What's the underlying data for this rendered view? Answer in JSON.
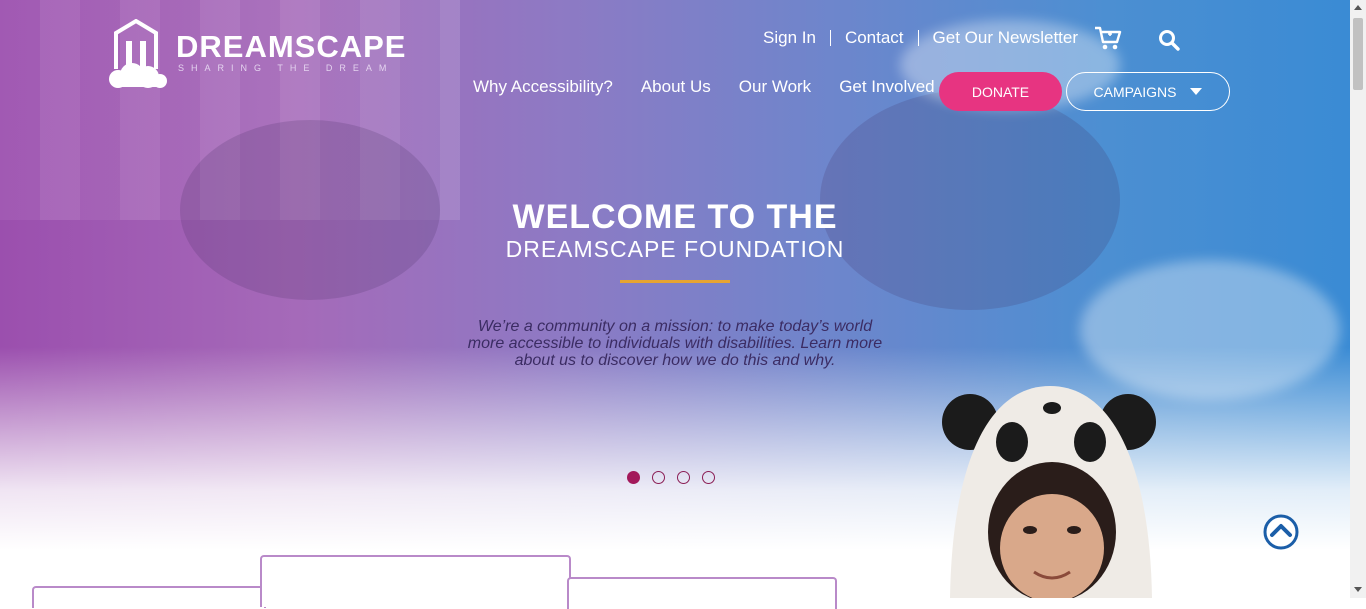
{
  "brand": {
    "name": "DREAMSCAPE",
    "tagline": "SHARING THE DREAM",
    "color_accent": "#e73481",
    "color_divider": "#e7a431"
  },
  "top_nav": {
    "items": [
      {
        "label": "Sign In"
      },
      {
        "label": "Contact"
      },
      {
        "label": "Get Our Newsletter"
      }
    ],
    "icons": [
      "cart-icon",
      "search-icon"
    ]
  },
  "main_nav": {
    "items": [
      {
        "label": "Why Accessibility?"
      },
      {
        "label": "About Us"
      },
      {
        "label": "Our Work"
      },
      {
        "label": "Get Involved"
      }
    ],
    "donate_label": "DONATE",
    "campaigns_label": "CAMPAIGNS"
  },
  "hero": {
    "title_line1": "WELCOME TO THE",
    "title_line2": "DREAMSCAPE FOUNDATION",
    "description": "We’re a community on a mission: to make today’s world more accessible to individuals with disabilities. Learn more about us to discover how we do this and why.",
    "slides": {
      "count": 4,
      "active": 1
    }
  }
}
